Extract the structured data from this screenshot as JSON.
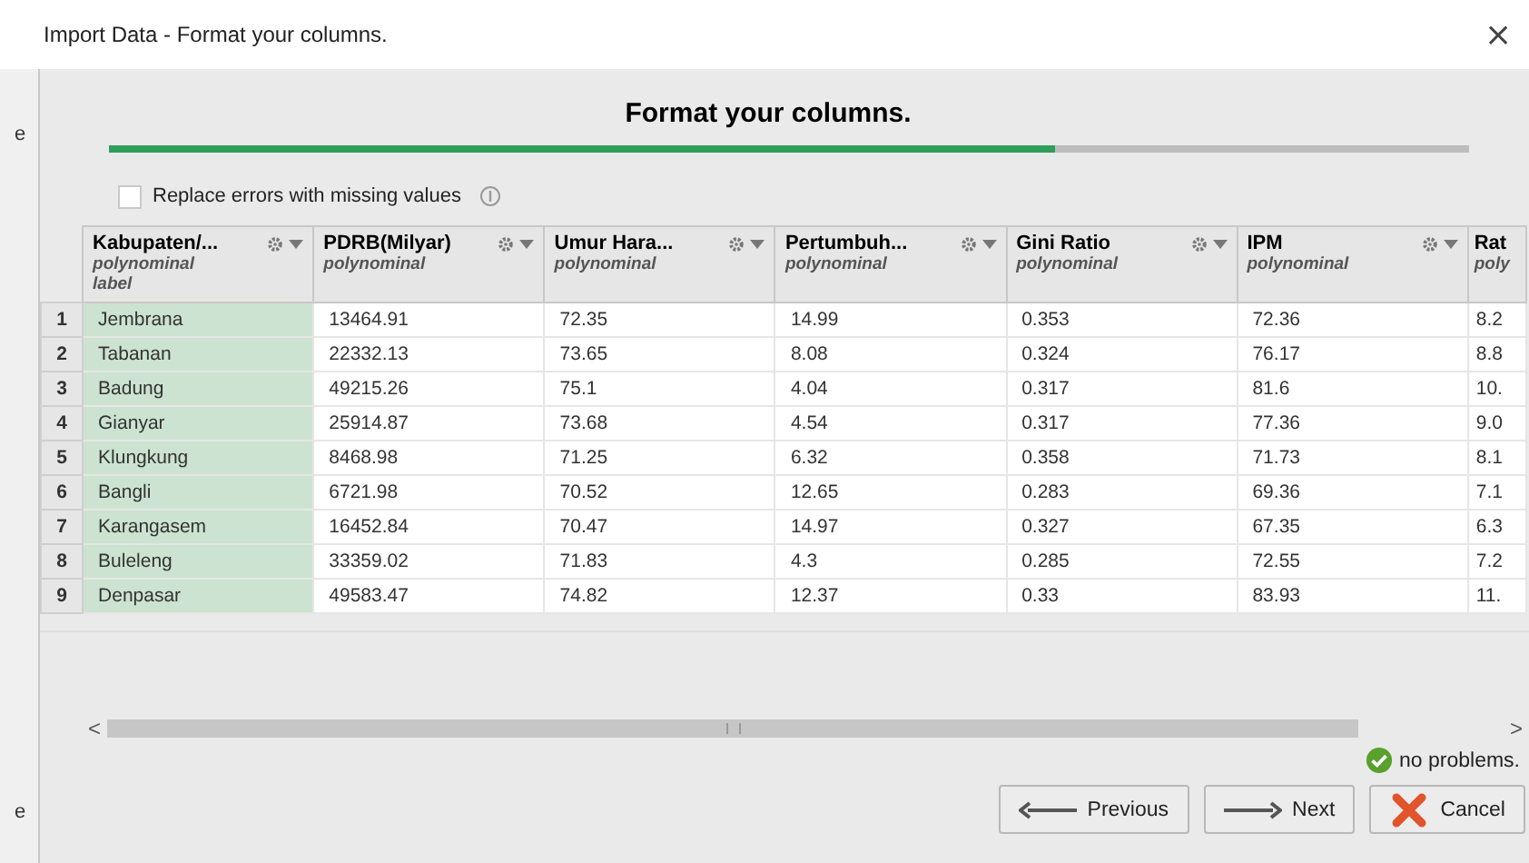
{
  "window": {
    "title": "Import Data - Format your columns.",
    "close": "×"
  },
  "background_window": {
    "texts": [
      "e",
      "e"
    ]
  },
  "heading": "Format your columns.",
  "progress": {
    "level": 0.695
  },
  "option": {
    "label": "Replace errors with missing values",
    "checked": false
  },
  "table": {
    "columns": [
      {
        "name": "Kabupaten/...",
        "type": "polynominal",
        "role": "label"
      },
      {
        "name": "PDRB(Milyar)",
        "type": "polynominal"
      },
      {
        "name": "Umur Hara...",
        "type": "polynominal"
      },
      {
        "name": "Pertumbuh...",
        "type": "polynominal"
      },
      {
        "name": "Gini Ratio",
        "type": "polynominal"
      },
      {
        "name": "IPM",
        "type": "polynominal"
      },
      {
        "name": "Rat",
        "type": "poly"
      }
    ],
    "rows": [
      {
        "number": "1",
        "cells": [
          "Jembrana",
          "13464.91",
          "72.35",
          "14.99",
          "0.353",
          "72.36",
          "8.2"
        ]
      },
      {
        "number": "2",
        "cells": [
          "Tabanan",
          "22332.13",
          "73.65",
          "8.08",
          "0.324",
          "76.17",
          "8.8"
        ]
      },
      {
        "number": "3",
        "cells": [
          "Badung",
          "49215.26",
          "75.1",
          "4.04",
          "0.317",
          "81.6",
          "10."
        ]
      },
      {
        "number": "4",
        "cells": [
          "Gianyar",
          "25914.87",
          "73.68",
          "4.54",
          "0.317",
          "77.36",
          "9.0"
        ]
      },
      {
        "number": "5",
        "cells": [
          "Klungkung",
          "8468.98",
          "71.25",
          "6.32",
          "0.358",
          "71.73",
          "8.1"
        ]
      },
      {
        "number": "6",
        "cells": [
          "Bangli",
          "6721.98",
          "70.52",
          "12.65",
          "0.283",
          "69.36",
          "7.1"
        ]
      },
      {
        "number": "7",
        "cells": [
          "Karangasem",
          "16452.84",
          "70.47",
          "14.97",
          "0.327",
          "67.35",
          "6.3"
        ]
      },
      {
        "number": "8",
        "cells": [
          "Buleleng",
          "33359.02",
          "71.83",
          "4.3",
          "0.285",
          "72.55",
          "7.2"
        ]
      },
      {
        "number": "9",
        "cells": [
          "Denpasar",
          "49583.47",
          "74.82",
          "12.37",
          "0.33",
          "83.93",
          "11."
        ]
      }
    ]
  },
  "scrollbar": {
    "left": "<",
    "right": ">"
  },
  "status": "no problems.",
  "buttons": [
    {
      "label": "Previous",
      "kind": "previous"
    },
    {
      "label": "Next",
      "kind": "next"
    },
    {
      "label": "Cancel",
      "kind": "cancel"
    }
  ]
}
